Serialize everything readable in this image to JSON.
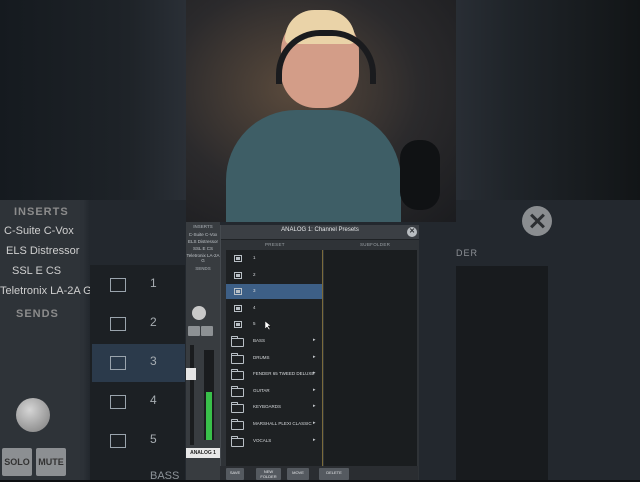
{
  "background": {
    "inserts_header": "INSERTS",
    "inserts": [
      "C-Suite C-Vox",
      "ELS Distressor",
      "SSL E CS",
      "Teletronix LA-2A G"
    ],
    "sends_header": "SENDS",
    "list_numbers": [
      "1",
      "2",
      "3",
      "4",
      "5"
    ],
    "partial_row": "BASS",
    "solo_label": "SOLO",
    "mute_label": "MUTE",
    "right_header": "DER"
  },
  "strip": {
    "inserts_header": "INSERTS",
    "inserts": [
      "C-Suite C-Vox",
      "ELS Distressor",
      "SSL E CS",
      "Teletronix LA-2A G"
    ],
    "sends_header": "SENDS",
    "channel_name": "ANALOG 1"
  },
  "dialog": {
    "title": "ANALOG 1: Channel Presets",
    "close_glyph": "✕",
    "preset_header": "PRESET",
    "subfolder_header": "SUBFOLDER",
    "presets": [
      {
        "label": "1",
        "type": "preset"
      },
      {
        "label": "2",
        "type": "preset"
      },
      {
        "label": "3",
        "type": "preset",
        "selected": true
      },
      {
        "label": "4",
        "type": "preset"
      },
      {
        "label": "5",
        "type": "preset"
      },
      {
        "label": "BASS",
        "type": "folder"
      },
      {
        "label": "DRUMS",
        "type": "folder"
      },
      {
        "label": "FENDER 65 TWEED DELUXE",
        "type": "folder"
      },
      {
        "label": "GUITAR",
        "type": "folder"
      },
      {
        "label": "KEYBOARDS",
        "type": "folder"
      },
      {
        "label": "MARSHALL PLEXI CLASSIC",
        "type": "folder"
      },
      {
        "label": "VOCALS",
        "type": "folder"
      }
    ],
    "folder_arrow": "▸",
    "buttons": [
      "SAVE",
      "NEW FOLDER",
      "MOVE",
      "DELETE"
    ]
  },
  "colors": {
    "selection": "#3d5f86",
    "meter_green": "#39c04a"
  }
}
